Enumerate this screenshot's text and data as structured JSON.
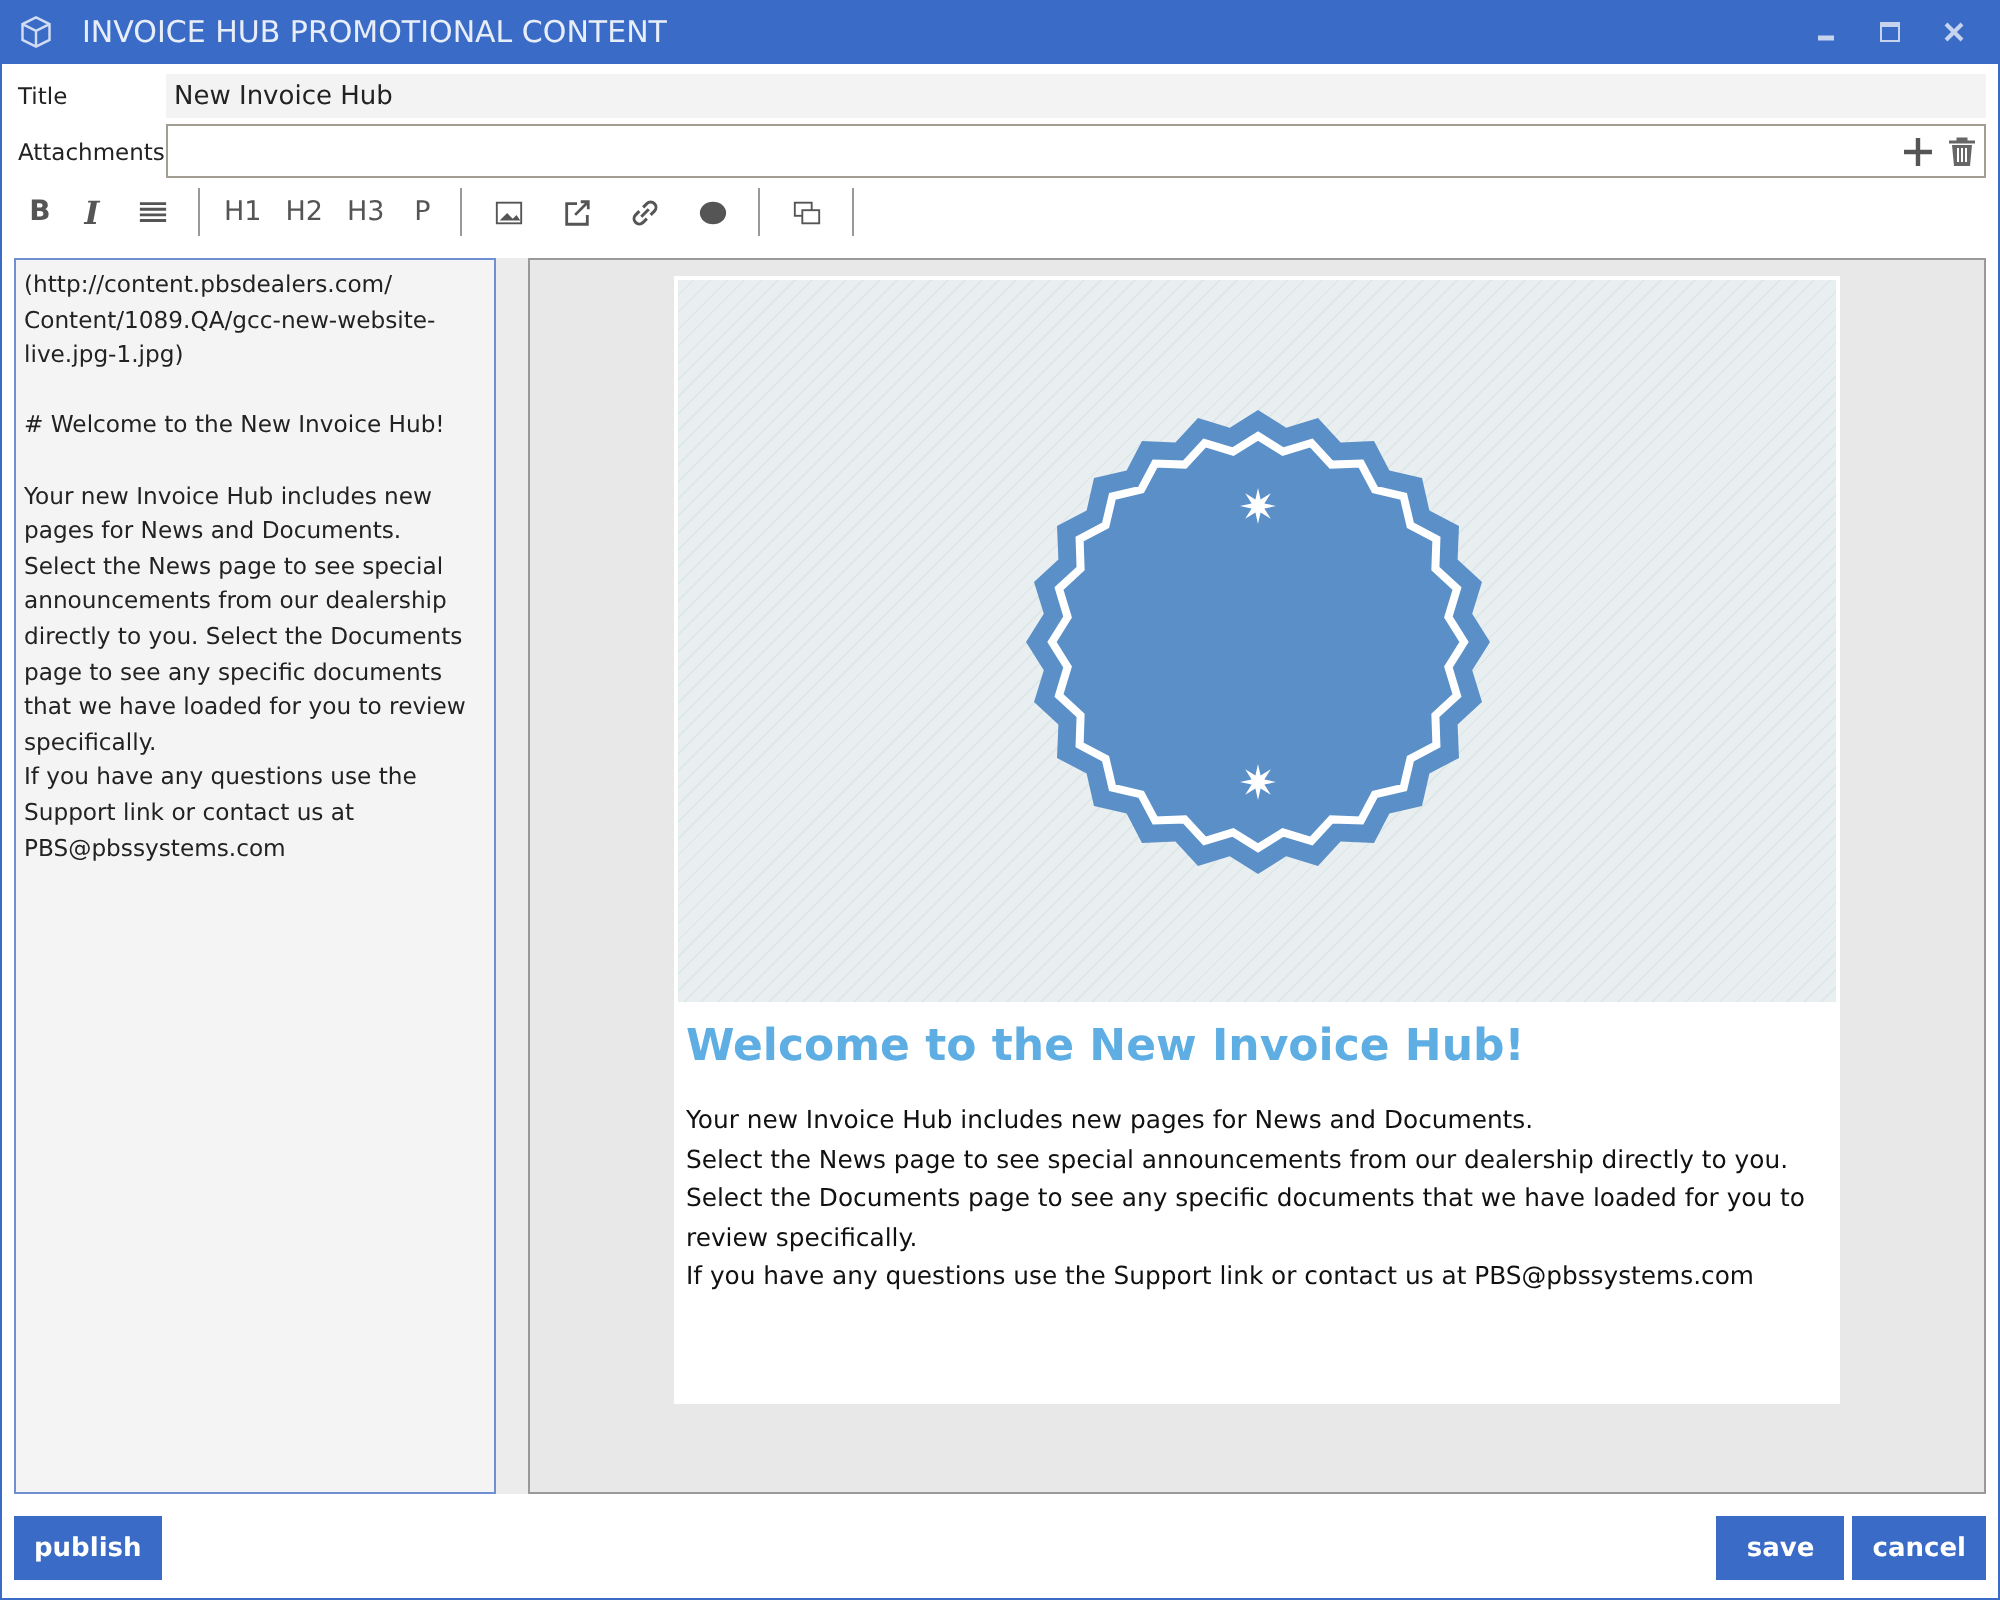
{
  "window": {
    "title": "INVOICE HUB PROMOTIONAL CONTENT"
  },
  "fields": [
    {
      "label": "Title",
      "value": "New Invoice Hub",
      "kind": "text"
    },
    {
      "label": "Attachments",
      "kind": "attachments"
    }
  ],
  "toolbar": [
    [
      {
        "kind": "bold",
        "label": "B"
      },
      {
        "kind": "italic",
        "label": "I"
      },
      {
        "kind": "align"
      }
    ],
    [
      {
        "kind": "heading",
        "label": "H1"
      },
      {
        "kind": "heading",
        "label": "H2"
      },
      {
        "kind": "heading",
        "label": "H3"
      },
      {
        "kind": "heading",
        "label": "P"
      }
    ],
    [
      {
        "kind": "image"
      },
      {
        "kind": "external"
      },
      {
        "kind": "link"
      },
      {
        "kind": "circle"
      }
    ],
    [
      {
        "kind": "window"
      }
    ]
  ],
  "editor": {
    "text": "(http://content.pbsdealers.com/ Content/1089.QA/gcc-new-website-live.jpg-1.jpg)\n\n# Welcome to the New Invoice Hub!\n\nYour new Invoice Hub includes new pages for News and Documents.\nSelect the News page to see special announcements from our dealership directly to you. Select the Documents page to see any specific documents that we have loaded for you to review specifically.\nIf you have any questions use the Support link or contact us at PBS@pbssystems.com"
  },
  "preview": {
    "heading": "Welcome to the New Invoice Hub!",
    "lines": [
      "Your new Invoice Hub includes new pages for News and Documents.",
      "Select the News page to see special announcements from our dealership directly to you.",
      "Select the Documents page to see any specific documents that we have loaded for you to review specifically.",
      "If you have any questions use the Support link or contact us at PBS@pbssystems.com"
    ]
  },
  "buttons_left": [
    "publish"
  ],
  "buttons_right": [
    "save",
    "cancel"
  ]
}
